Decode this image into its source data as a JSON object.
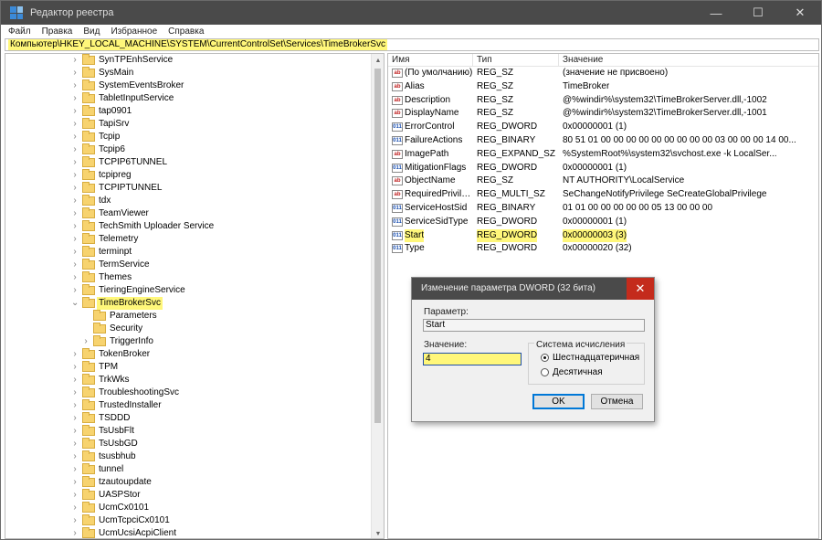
{
  "window": {
    "title": "Редактор реестра",
    "controls": {
      "minimize": "—",
      "maximize": "☐",
      "close": "✕"
    }
  },
  "menu": [
    "Файл",
    "Правка",
    "Вид",
    "Избранное",
    "Справка"
  ],
  "address": "Компьютер\\HKEY_LOCAL_MACHINE\\SYSTEM\\CurrentControlSet\\Services\\TimeBrokerSvc",
  "tree": {
    "expand_glyph": "›",
    "collapse_glyph": "⌄",
    "items": [
      {
        "label": "SynTPEnhService",
        "expandable": true,
        "level": 0
      },
      {
        "label": "SysMain",
        "expandable": true,
        "level": 0
      },
      {
        "label": "SystemEventsBroker",
        "expandable": true,
        "level": 0
      },
      {
        "label": "TabletInputService",
        "expandable": true,
        "level": 0
      },
      {
        "label": "tap0901",
        "expandable": true,
        "level": 0
      },
      {
        "label": "TapiSrv",
        "expandable": true,
        "level": 0
      },
      {
        "label": "Tcpip",
        "expandable": true,
        "level": 0
      },
      {
        "label": "Tcpip6",
        "expandable": true,
        "level": 0
      },
      {
        "label": "TCPIP6TUNNEL",
        "expandable": true,
        "level": 0
      },
      {
        "label": "tcpipreg",
        "expandable": true,
        "level": 0
      },
      {
        "label": "TCPIPTUNNEL",
        "expandable": true,
        "level": 0
      },
      {
        "label": "tdx",
        "expandable": true,
        "level": 0
      },
      {
        "label": "TeamViewer",
        "expandable": true,
        "level": 0
      },
      {
        "label": "TechSmith Uploader Service",
        "expandable": true,
        "level": 0
      },
      {
        "label": "Telemetry",
        "expandable": true,
        "level": 0
      },
      {
        "label": "terminpt",
        "expandable": true,
        "level": 0
      },
      {
        "label": "TermService",
        "expandable": true,
        "level": 0
      },
      {
        "label": "Themes",
        "expandable": true,
        "level": 0
      },
      {
        "label": "TieringEngineService",
        "expandable": true,
        "level": 0
      },
      {
        "label": "TimeBrokerSvc",
        "expandable": true,
        "expanded": true,
        "selected": true,
        "level": 0
      },
      {
        "label": "Parameters",
        "expandable": false,
        "level": 1
      },
      {
        "label": "Security",
        "expandable": false,
        "level": 1
      },
      {
        "label": "TriggerInfo",
        "expandable": true,
        "level": 1
      },
      {
        "label": "TokenBroker",
        "expandable": true,
        "level": 0
      },
      {
        "label": "TPM",
        "expandable": true,
        "level": 0
      },
      {
        "label": "TrkWks",
        "expandable": true,
        "level": 0
      },
      {
        "label": "TroubleshootingSvc",
        "expandable": true,
        "level": 0
      },
      {
        "label": "TrustedInstaller",
        "expandable": true,
        "level": 0
      },
      {
        "label": "TSDDD",
        "expandable": true,
        "level": 0
      },
      {
        "label": "TsUsbFlt",
        "expandable": true,
        "level": 0
      },
      {
        "label": "TsUsbGD",
        "expandable": true,
        "level": 0
      },
      {
        "label": "tsusbhub",
        "expandable": true,
        "level": 0
      },
      {
        "label": "tunnel",
        "expandable": true,
        "level": 0
      },
      {
        "label": "tzautoupdate",
        "expandable": true,
        "level": 0
      },
      {
        "label": "UASPStor",
        "expandable": true,
        "level": 0
      },
      {
        "label": "UcmCx0101",
        "expandable": true,
        "level": 0
      },
      {
        "label": "UcmTcpciCx0101",
        "expandable": true,
        "level": 0
      },
      {
        "label": "UcmUcsiAcpiClient",
        "expandable": true,
        "level": 0
      }
    ]
  },
  "scrollbar": {
    "up": "▲",
    "down": "▼"
  },
  "list": {
    "columns": {
      "name": "Имя",
      "type": "Тип",
      "value": "Значение"
    },
    "icon_text": {
      "sz": "ab",
      "bin": "011"
    },
    "rows": [
      {
        "name": "(По умолчанию)",
        "type": "REG_SZ",
        "value": "(значение не присвоено)",
        "icon": "sz"
      },
      {
        "name": "Alias",
        "type": "REG_SZ",
        "value": "TimeBroker",
        "icon": "sz"
      },
      {
        "name": "Description",
        "type": "REG_SZ",
        "value": "@%windir%\\system32\\TimeBrokerServer.dll,-1002",
        "icon": "sz"
      },
      {
        "name": "DisplayName",
        "type": "REG_SZ",
        "value": "@%windir%\\system32\\TimeBrokerServer.dll,-1001",
        "icon": "sz"
      },
      {
        "name": "ErrorControl",
        "type": "REG_DWORD",
        "value": "0x00000001 (1)",
        "icon": "bin"
      },
      {
        "name": "FailureActions",
        "type": "REG_BINARY",
        "value": "80 51 01 00 00 00 00 00 00 00 00 00 03 00 00 00 14 00...",
        "icon": "bin"
      },
      {
        "name": "ImagePath",
        "type": "REG_EXPAND_SZ",
        "value": "%SystemRoot%\\system32\\svchost.exe -k LocalSer...",
        "icon": "sz"
      },
      {
        "name": "MitigationFlags",
        "type": "REG_DWORD",
        "value": "0x00000001 (1)",
        "icon": "bin"
      },
      {
        "name": "ObjectName",
        "type": "REG_SZ",
        "value": "NT AUTHORITY\\LocalService",
        "icon": "sz"
      },
      {
        "name": "RequiredPrivileg...",
        "type": "REG_MULTI_SZ",
        "value": "SeChangeNotifyPrivilege SeCreateGlobalPrivilege",
        "icon": "sz"
      },
      {
        "name": "ServiceHostSid",
        "type": "REG_BINARY",
        "value": "01 01 00 00 00 00 00 05 13 00 00 00",
        "icon": "bin"
      },
      {
        "name": "ServiceSidType",
        "type": "REG_DWORD",
        "value": "0x00000001 (1)",
        "icon": "bin"
      },
      {
        "name": "Start",
        "type": "REG_DWORD",
        "value": "0x00000003 (3)",
        "icon": "bin",
        "selected": true
      },
      {
        "name": "Type",
        "type": "REG_DWORD",
        "value": "0x00000020 (32)",
        "icon": "bin"
      }
    ]
  },
  "dialog": {
    "title": "Изменение параметра DWORD (32 бита)",
    "close": "✕",
    "param_label": "Параметр:",
    "param_value": "Start",
    "value_label": "Значение:",
    "value": "4",
    "base_label": "Система исчисления",
    "radio_hex": "Шестнадцатеричная",
    "radio_dec": "Десятичная",
    "hex_selected": true,
    "ok": "OK",
    "cancel": "Отмена"
  }
}
